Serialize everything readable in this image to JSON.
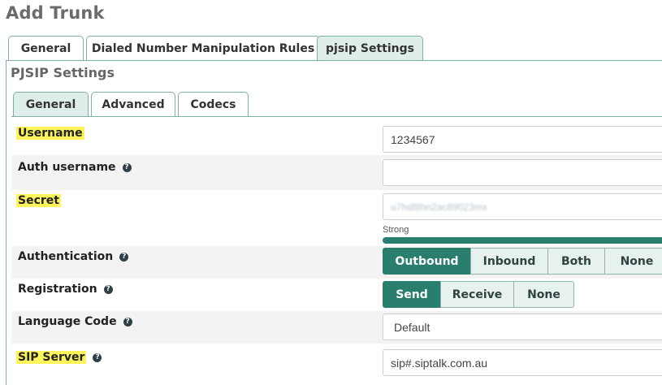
{
  "page": {
    "title": "Add Trunk"
  },
  "outer_tabs": [
    {
      "label": "General",
      "active": false
    },
    {
      "label": "Dialed Number Manipulation Rules",
      "active": false
    },
    {
      "label": "pjsip Settings",
      "active": true
    }
  ],
  "section": {
    "title": "PJSIP Settings"
  },
  "inner_tabs": [
    {
      "label": "General",
      "active": true
    },
    {
      "label": "Advanced",
      "active": false
    },
    {
      "label": "Codecs",
      "active": false
    }
  ],
  "fields": {
    "username": {
      "label": "Username",
      "value": "1234567",
      "highlighted": true
    },
    "auth_username": {
      "label": "Auth username",
      "value": "",
      "help": "?"
    },
    "secret": {
      "label": "Secret",
      "value": "u7hdf8hn2ac89023mx",
      "highlighted": true,
      "strength_label": "Strong",
      "strength_level": 1.0
    },
    "authentication": {
      "label": "Authentication",
      "help": "?",
      "options": [
        "Outbound",
        "Inbound",
        "Both",
        "None"
      ],
      "selected": "Outbound"
    },
    "registration": {
      "label": "Registration",
      "help": "?",
      "options": [
        "Send",
        "Receive",
        "None"
      ],
      "selected": "Send"
    },
    "language_code": {
      "label": "Language Code",
      "help": "?",
      "value": "Default"
    },
    "sip_server": {
      "label": "SIP Server",
      "help": "?",
      "value": "sip#.siptalk.com.au",
      "highlighted": true
    }
  },
  "colors": {
    "accent": "#2a7e6e",
    "highlight": "#fcf45a",
    "tab_active_bg": "#dfeeea",
    "row_band": "#f3f3f3"
  }
}
